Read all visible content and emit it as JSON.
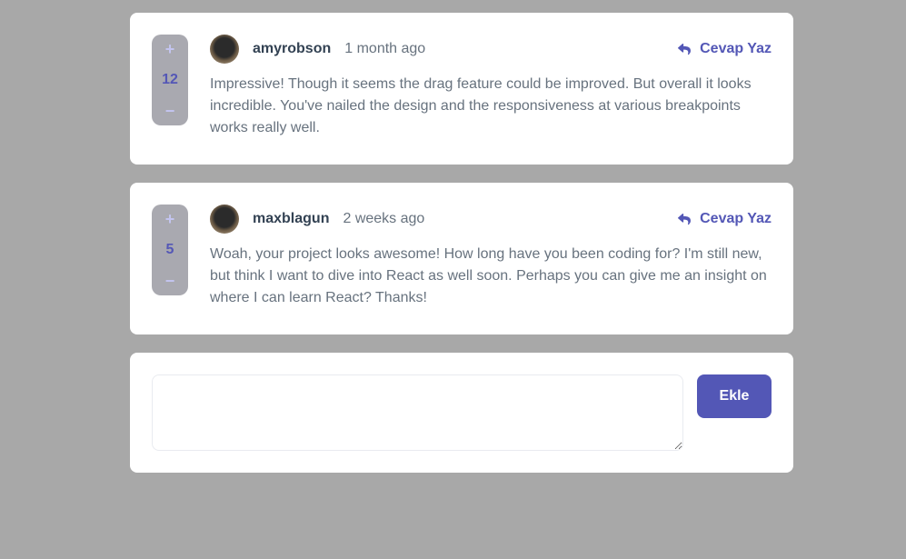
{
  "comments": [
    {
      "score": "12",
      "plus_label": "+",
      "minus_label": "−",
      "username": "amyrobson",
      "time": "1 month ago",
      "reply_label": "Cevap Yaz",
      "text": "Impressive! Though it seems the drag feature could be improved. But overall it looks incredible. You've nailed the design and the responsiveness at various breakpoints works really well."
    },
    {
      "score": "5",
      "plus_label": "+",
      "minus_label": "−",
      "username": "maxblagun",
      "time": "2 weeks ago",
      "reply_label": "Cevap Yaz",
      "text": "Woah, your project looks awesome! How long have you been coding for? I'm still new, but think I want to dive into React as well soon. Perhaps you can give me an insight on where I can learn React? Thanks!"
    }
  ],
  "form": {
    "input_value": "",
    "input_placeholder": "",
    "submit_label": "Ekle"
  },
  "colors": {
    "accent": "#5357b6",
    "background": "#a8a8a8",
    "card": "#ffffff",
    "score_bg": "#a9a9b0"
  },
  "icons": {
    "reply": "reply-arrow-icon",
    "avatar": "user-avatar"
  }
}
